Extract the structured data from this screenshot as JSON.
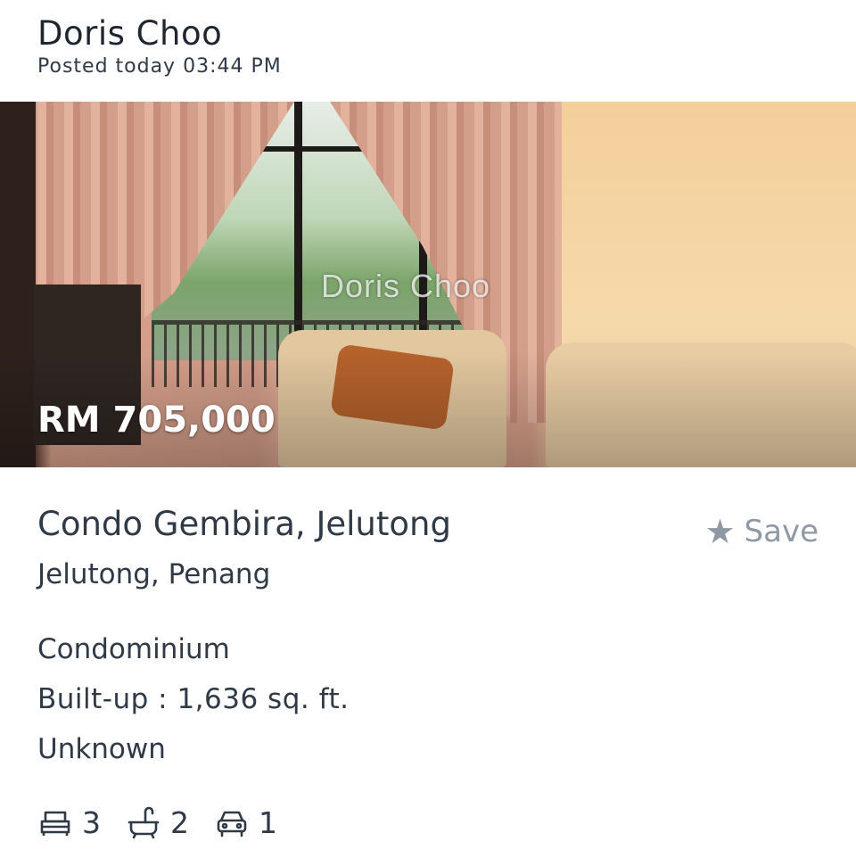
{
  "header": {
    "agent_name": "Doris Choo",
    "posted": "Posted today 03:44 PM"
  },
  "photo": {
    "watermark": "Doris Choo",
    "price": "RM 705,000"
  },
  "listing": {
    "title": "Condo Gembira, Jelutong",
    "location": "Jelutong, Penang",
    "save_label": "Save",
    "property_type": "Condominium",
    "built_up": "Built-up : 1,636 sq. ft.",
    "tenure": "Unknown"
  },
  "features": {
    "bedrooms": "3",
    "bathrooms": "2",
    "parking": "1"
  },
  "icons": {
    "save": "star-icon",
    "bedrooms": "bed-icon",
    "bathrooms": "bathtub-icon",
    "parking": "car-icon"
  }
}
